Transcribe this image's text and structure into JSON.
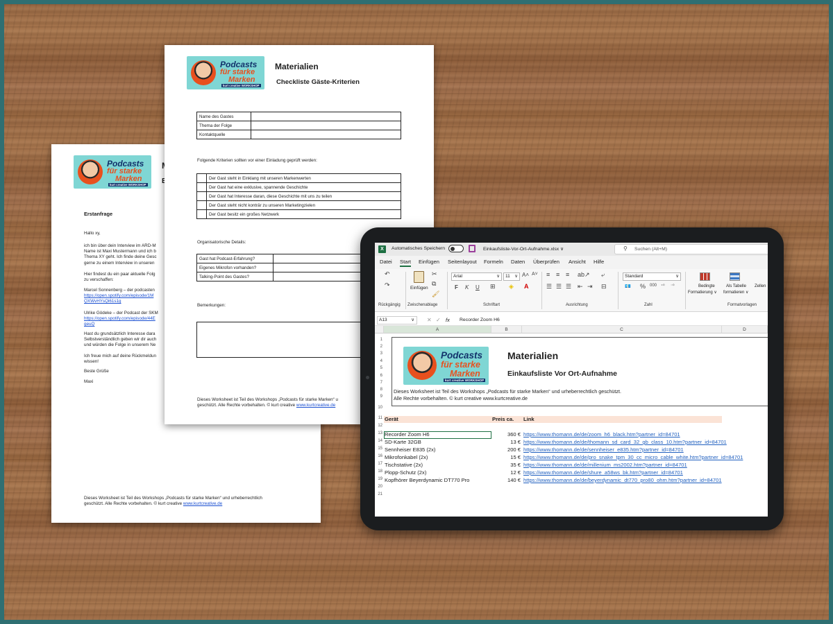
{
  "doc_back": {
    "heading_title_partial": "M",
    "heading_sub_partial": "E",
    "section": "Erstanfrage",
    "greeting": "Hallo xy,",
    "para1_lines": [
      "ich bin über dein Interview im ARD-M",
      "Name ist Maxi Mustermann und ich b",
      "Thema XY geht. Ich finde deine Gesc",
      "gerne zu einem Interview in unseren"
    ],
    "para2_lines": [
      "Hier findest du ein paar aktuelle Folg",
      "zu verschaffen:"
    ],
    "ref1_text": "Marcel Sonnenberg – der podcasten",
    "ref1_link_lines": [
      "https://open.spotify.com/episode/1M",
      "QXWvHYsQi61s1g"
    ],
    "ref2_text": "Ulrike Gödeke – der Podcast der SKM",
    "ref2_link_lines": [
      "https://open.spotify.com/episode/44E",
      "geuQ"
    ],
    "para3_lines": [
      "Hast du grundsätzlich Interesse dara",
      "Selbstverständlich geben wir dir auch",
      "und würden die Folge in unserem Ne"
    ],
    "para4_lines": [
      "Ich freue mich auf deine Rückmeldun",
      "wissen!"
    ],
    "closing": "Beste Grüße",
    "sign": "Maxi",
    "footer_line1": "Dieses Worksheet ist Teil des Workshops „Podcasts für starke Marken“ und urheberrechtlich",
    "footer_line2": "geschützt. Alle Rechte vorbehalten. © kurt creative ",
    "footer_link": "www.kurtcreative.de"
  },
  "logo": {
    "line1": "Podcasts",
    "line2": "für starke",
    "line3": "Marken",
    "tag": "kurt creative WORKSHOP"
  },
  "doc_front": {
    "title": "Materialien",
    "subtitle": "Checkliste Gäste-Kriterien",
    "table1": [
      "Name des Gastes",
      "Thema der Folge",
      "Kontaktquelle"
    ],
    "criteria_intro": "Folgende Kriterien sollten vor einer Einladung geprüft werden:",
    "criteria": [
      "Der Gast steht in Einklang mit unseren Markenwerten",
      "Der Gast hat eine exklusive, spannende Geschichte",
      "Der Gast hat Interesse daran, diese Geschichte mit uns zu teilen",
      "Der Gast steht nicht konträr zu unseren Marketingzielen",
      "Der Gast besitz ein großes Netzwerk"
    ],
    "org_title": "Organisatorische Details:",
    "org_rows": [
      "Gast hat Podcast-Erfahrung?",
      "Eigenes Mikrofon vorhanden?",
      "Talking-Point des Gastes?"
    ],
    "remarks": "Bemerkungen:",
    "footer_line1": "Dieses Worksheet ist Teil des Workshops „Podcasts für starke Marken“ u",
    "footer_line2": "geschützt. Alle Rechte vorbehalten. © kurt creative ",
    "footer_link": "www.kurtcreative.de"
  },
  "excel": {
    "autosave_label": "Automatisches Speichern",
    "filename": "Einkaufsliste-Vor-Ort-Aufnahme.xlsx ∨",
    "search_placeholder": "Suchen (Alt+M)",
    "menu": [
      "Datei",
      "Start",
      "Einfügen",
      "Seitenlayout",
      "Formeln",
      "Daten",
      "Überprüfen",
      "Ansicht",
      "Hilfe"
    ],
    "ribbon": {
      "undo_group": "Rückgängig",
      "paste_label": "Einfügen",
      "clipboard_group": "Zwischenablage",
      "font_name": "Arial",
      "font_size": "11",
      "font_group": "Schriftart",
      "align_group": "Ausrichtung",
      "number_format": "Standard",
      "number_group": "Zahl",
      "cond_format_1": "Bedingte",
      "cond_format_2": "Formatierung ∨",
      "table_format_1": "Als Tabelle",
      "table_format_2": "formatieren ∨",
      "cells_label": "Zellen",
      "styles_group": "Formatvorlagen",
      "bold": "F",
      "italic": "K",
      "underline": "U"
    },
    "name_box": "A13",
    "fx": "fx",
    "formula": "Recorder Zoom H6",
    "columns": [
      "A",
      "B",
      "C",
      "D"
    ],
    "rows": [
      "1",
      "2",
      "3",
      "4",
      "5",
      "6",
      "7",
      "8",
      "9",
      "10",
      "11",
      "12",
      "13",
      "14",
      "15",
      "16",
      "17",
      "18",
      "19",
      "20",
      "21"
    ],
    "sheet_title": "Materialien",
    "sheet_subtitle": "Einkaufsliste Vor Ort-Aufnahme",
    "sheet_note_1": "Dieses Worksheet ist Teil des Workshops „Podcasts für starke Marken“ und urheberrechtlich geschützt.",
    "sheet_note_2": "Alle Rechte vorbehalten. © kurt creative www.kurtcreative.de",
    "headers": [
      "Gerät",
      "Preis ca.",
      "Link"
    ],
    "items": [
      {
        "name": "Recorder Zoom H6",
        "price": "360 €",
        "link": "https://www.thomann.de/de/zoom_h6_black.htm?partner_id=84701"
      },
      {
        "name": "SD-Karte 32GB",
        "price": "13 €",
        "link": "https://www.thomann.de/de/thomann_sd_card_32_gb_class_10.htm?partner_id=84701"
      },
      {
        "name": "Sennheiser E835 (2x)",
        "price": "200 €",
        "link": "https://www.thomann.de/de/sennheiser_e835.htm?partner_id=84701"
      },
      {
        "name": "Mikrofonkabel (2x)",
        "price": "15 €",
        "link": "https://www.thomann.de/de/pro_snake_tpm_30_cc_micro_cable_white.htm?partner_id=84701"
      },
      {
        "name": "Tischstative (2x)",
        "price": "35 €",
        "link": "https://www.thomann.de/de/millenium_ms2002.htm?partner_id=84701"
      },
      {
        "name": "Plopp-Schutz (2x)",
        "price": "12 €",
        "link": "https://www.thomann.de/de/shure_a58ws_bk.htm?partner_id=84701"
      },
      {
        "name": "Kopfhörer Beyerdynamic DT770 Pro",
        "price": "140 €",
        "link": "https://www.thomann.de/de/beyerdynamic_dt770_pro80_ohm.htm?partner_id=84701"
      }
    ]
  }
}
